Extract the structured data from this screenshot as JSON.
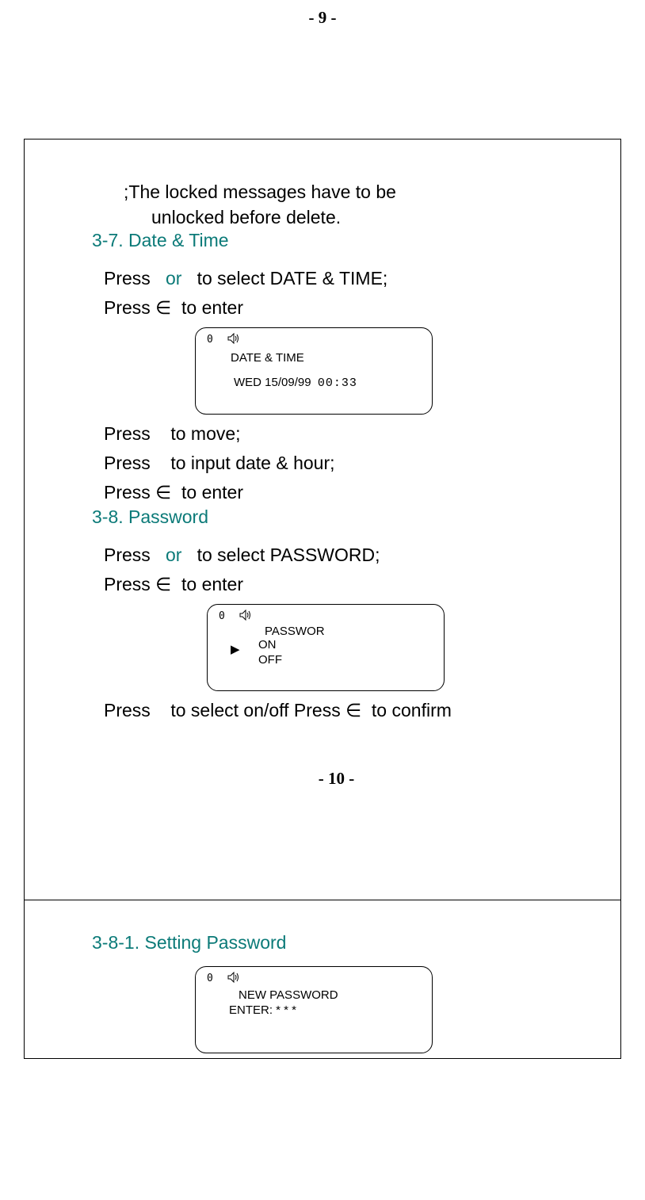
{
  "page_top": "- 9 -",
  "note_line1": ";The locked messages have to be",
  "note_line2": "unlocked before delete.",
  "sec37": "3-7. Date & Time",
  "instr_37_1a": "Press",
  "or": "or",
  "instr_37_1b": "to select DATE & TIME;",
  "instr_37_2a": "Press ∈",
  "instr_37_2b": "to enter",
  "lcd1_title": "DATE & TIME",
  "lcd1_date_prefix": "WED   15/09/99",
  "lcd1_time": "00:33",
  "instr_37_3": "to move;",
  "instr_37_4": "to input date & hour;",
  "instr_37_5a": "Press ∈",
  "instr_37_5b": "to enter",
  "sec38": "3-8. Password",
  "instr_38_1b": "to select PASSWORD;",
  "lcd2_title": "PASSWOR",
  "lcd2_on": "ON",
  "lcd2_off": "OFF",
  "instr_38_3a": "Press",
  "instr_38_3b": "to select on/off Press ∈",
  "instr_38_3c": "to confirm",
  "page_mid": "- 10 -",
  "sec381": "3-8-1. Setting Password",
  "lcd3_title": "NEW PASSWORD",
  "lcd3_enter": "ENTER: * * *",
  "battery_glyph": "0",
  "speaker_glyph": "🔊",
  "arrow_glyph": "▶",
  "press": "Press"
}
